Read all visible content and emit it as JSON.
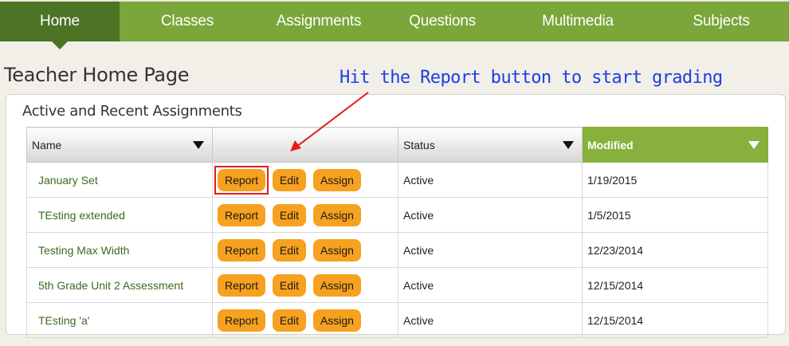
{
  "nav": {
    "items": [
      {
        "label": "Home",
        "active": true
      },
      {
        "label": "Classes",
        "active": false
      },
      {
        "label": "Assignments",
        "active": false
      },
      {
        "label": "Questions",
        "active": false
      },
      {
        "label": "Multimedia",
        "active": false
      },
      {
        "label": "Subjects",
        "active": false
      }
    ]
  },
  "page": {
    "title": "Teacher Home Page",
    "annotation": "Hit the Report button to start grading"
  },
  "panel": {
    "title": "Active and Recent Assignments",
    "columns": [
      "Name",
      "",
      "Status",
      "Modified"
    ],
    "sorted_column": "Modified",
    "button_labels": {
      "report": "Report",
      "edit": "Edit",
      "assign": "Assign"
    },
    "rows": [
      {
        "name": "January Set",
        "status": "Active",
        "modified": "1/19/2015"
      },
      {
        "name": "TEsting extended",
        "status": "Active",
        "modified": "1/5/2015"
      },
      {
        "name": "Testing Max Width",
        "status": "Active",
        "modified": "12/23/2014"
      },
      {
        "name": "5th Grade Unit 2 Assessment",
        "status": "Active",
        "modified": "12/15/2014"
      },
      {
        "name": "TEsting 'a'",
        "status": "Active",
        "modified": "12/15/2014"
      }
    ]
  },
  "colors": {
    "nav_bg": "#7aa63a",
    "nav_active": "#4c7424",
    "button": "#f6a11f",
    "annotation": "#1c3fe0",
    "highlight": "#e31c1c"
  }
}
